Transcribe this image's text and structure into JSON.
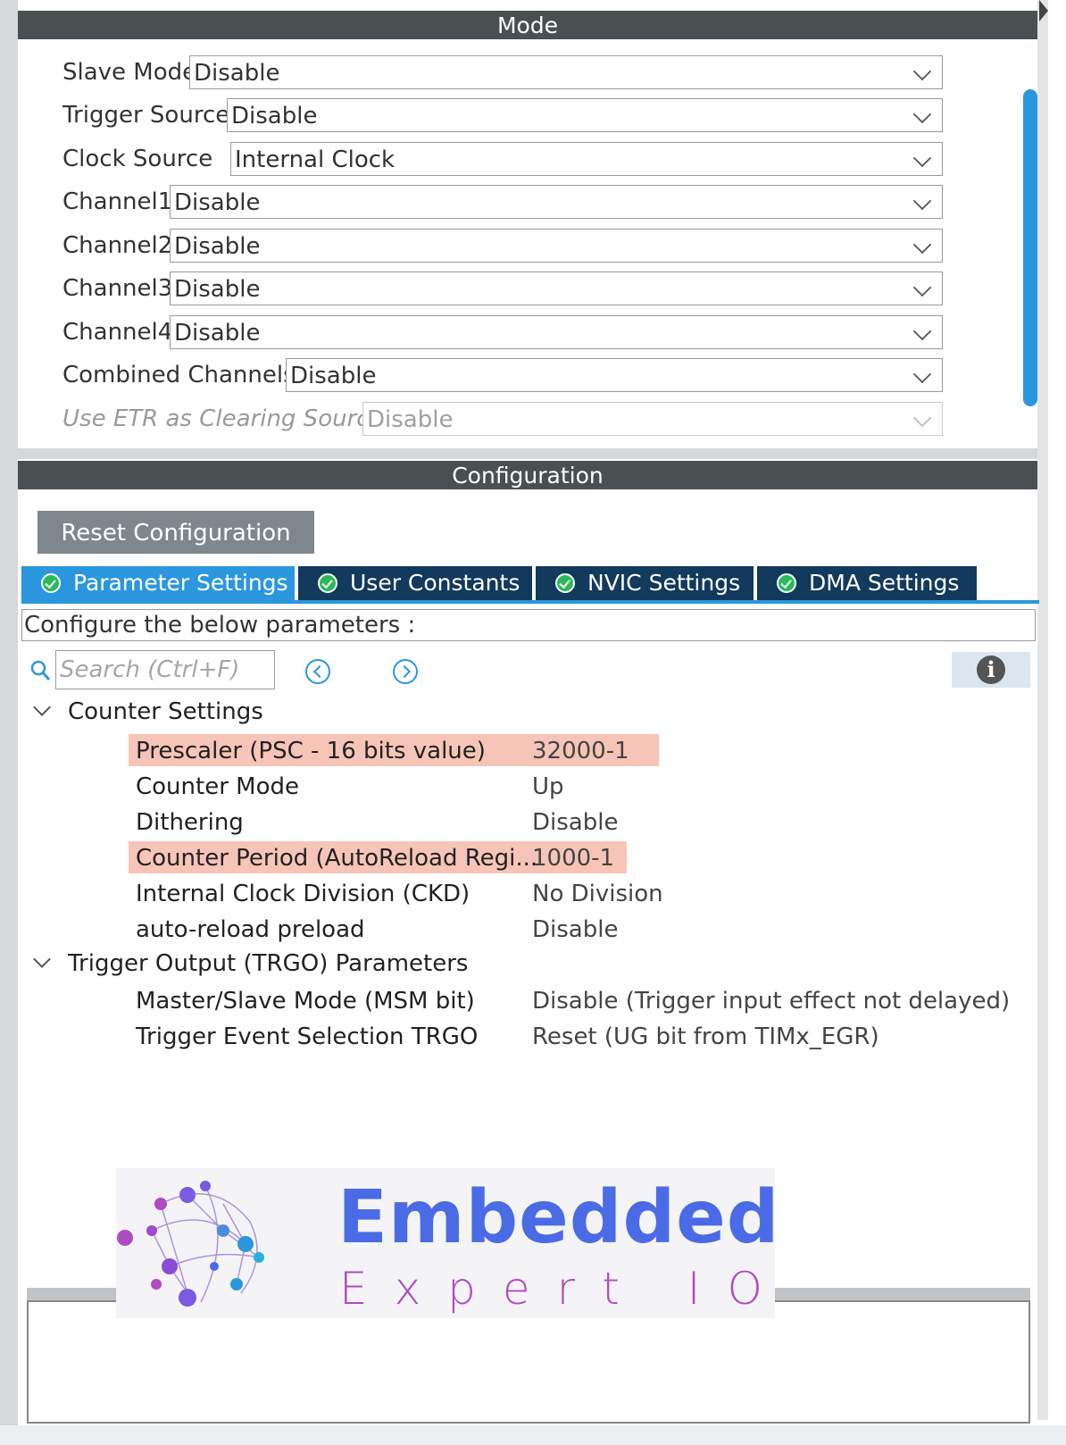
{
  "mode": {
    "header": "Mode",
    "rows": [
      {
        "label": "Slave Mode",
        "value": "Disable"
      },
      {
        "label": "Trigger Source",
        "value": "Disable"
      },
      {
        "label": "Clock Source",
        "value": "Internal Clock"
      },
      {
        "label": "Channel1",
        "value": "Disable"
      },
      {
        "label": "Channel2",
        "value": "Disable"
      },
      {
        "label": "Channel3",
        "value": "Disable"
      },
      {
        "label": "Channel4",
        "value": "Disable"
      },
      {
        "label": "Combined Channels",
        "value": "Disable"
      },
      {
        "label": "Use ETR as Clearing Source",
        "value": "Disable",
        "disabled": true
      }
    ]
  },
  "configuration": {
    "header": "Configuration",
    "reset_label": "Reset Configuration",
    "tabs": [
      {
        "label": "Parameter Settings",
        "active": true
      },
      {
        "label": "User Constants"
      },
      {
        "label": "NVIC Settings"
      },
      {
        "label": "DMA Settings"
      }
    ],
    "instruction": "Configure the below parameters :",
    "search_placeholder": "Search (Ctrl+F)",
    "groups": [
      {
        "name": "Counter Settings",
        "params": [
          {
            "name": "Prescaler (PSC - 16 bits value)",
            "value": "32000-1",
            "highlight": true
          },
          {
            "name": "Counter Mode",
            "value": "Up"
          },
          {
            "name": "Dithering",
            "value": "Disable"
          },
          {
            "name": "Counter Period (AutoReload Regi...",
            "value": "1000-1",
            "highlight": true
          },
          {
            "name": "Internal Clock Division (CKD)",
            "value": "No Division"
          },
          {
            "name": "auto-reload preload",
            "value": "Disable"
          }
        ]
      },
      {
        "name": "Trigger Output (TRGO) Parameters",
        "params": [
          {
            "name": "Master/Slave Mode (MSM bit)",
            "value": "Disable (Trigger input effect not delayed)"
          },
          {
            "name": "Trigger Event Selection TRGO",
            "value": "Reset (UG bit from TIMx_EGR)"
          }
        ]
      }
    ]
  },
  "watermark": {
    "title": "Embedded",
    "subtitle": "Expert IO"
  },
  "colors": {
    "accent": "#2b97de",
    "tab_dark": "#113a5c",
    "highlight": "#f7c5b7",
    "header": "#4a4f51"
  }
}
